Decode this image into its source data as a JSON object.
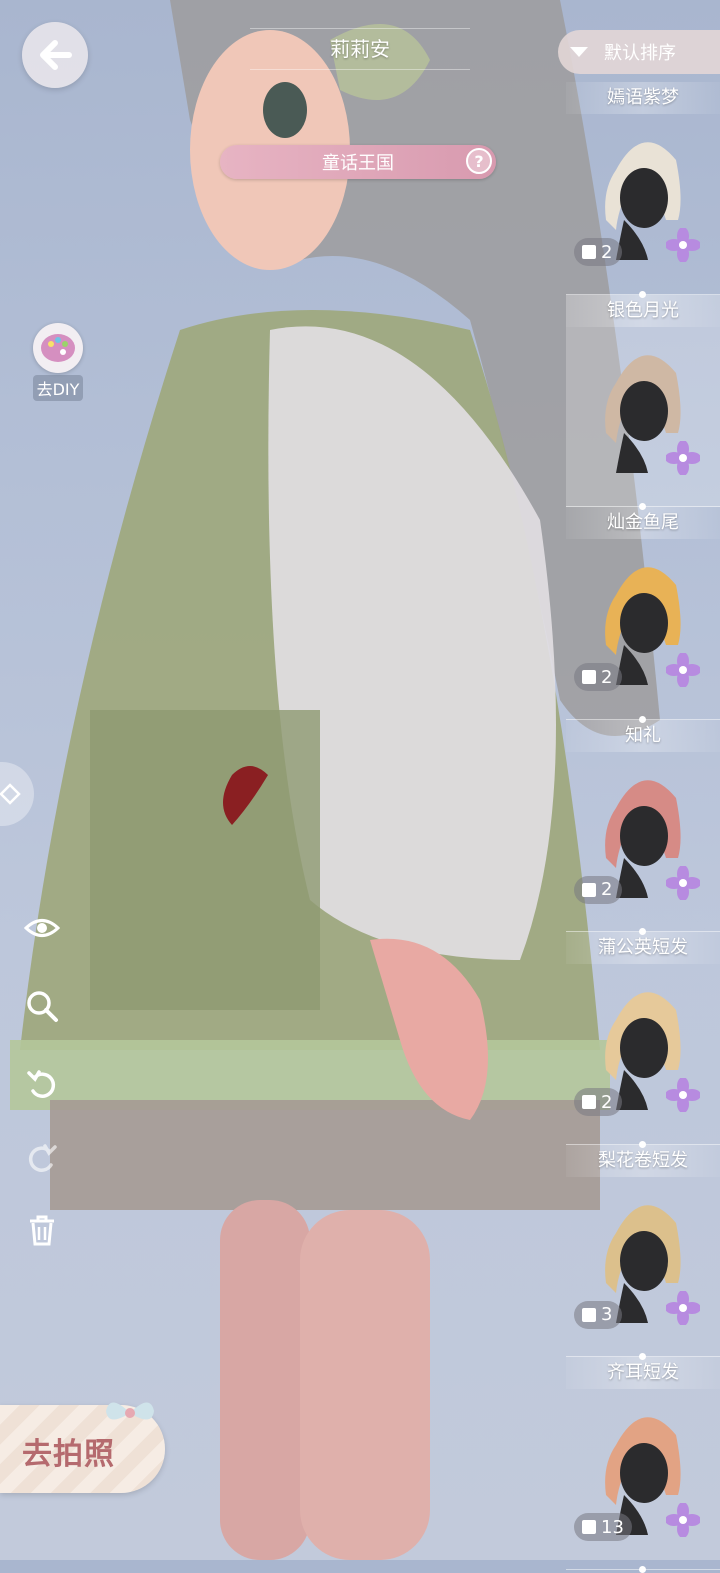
{
  "header": {
    "title": "莉莉安",
    "theme": "童话王国"
  },
  "sort": {
    "label": "默认排序"
  },
  "left": {
    "diy_label": "去DIY",
    "photo_label": "去拍照"
  },
  "hair_items": [
    {
      "name": "嫣语紫梦",
      "count": "2",
      "color": "#e9e2d6"
    },
    {
      "name": "银色月光",
      "count": "",
      "color": "#cfb8a4"
    },
    {
      "name": "灿金鱼尾",
      "count": "2",
      "color": "#e8b256"
    },
    {
      "name": "知礼",
      "count": "2",
      "color": "#d68b86"
    },
    {
      "name": "蒲公英短发",
      "count": "2",
      "color": "#e6c99a"
    },
    {
      "name": "梨花卷短发",
      "count": "3",
      "color": "#dcc08c"
    },
    {
      "name": "齐耳短发",
      "count": "13",
      "color": "#e2a384"
    }
  ],
  "colors": {
    "accent_pink": "#d89aaf",
    "flower_purple": "#b78be0"
  }
}
